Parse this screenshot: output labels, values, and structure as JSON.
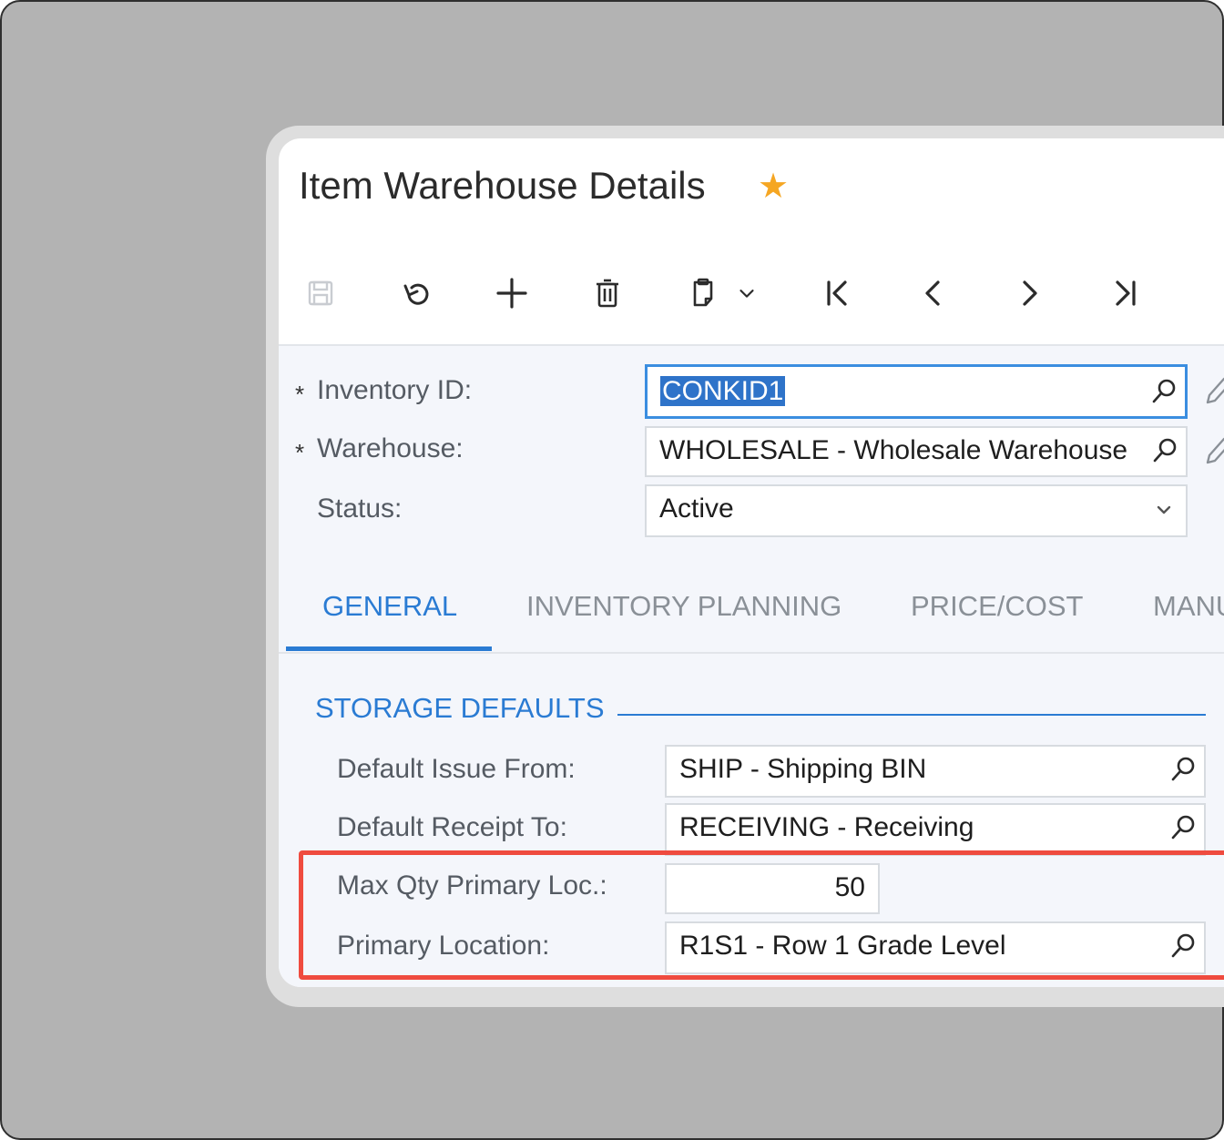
{
  "window": {
    "title": "Item Warehouse Details",
    "favorite_icon": "star-icon",
    "favorite_color": "#f5a623"
  },
  "toolbar": {
    "buttons": [
      {
        "name": "save",
        "icon": "save-icon"
      },
      {
        "name": "undo",
        "icon": "undo-icon"
      },
      {
        "name": "add",
        "icon": "plus-icon"
      },
      {
        "name": "delete",
        "icon": "trash-icon"
      },
      {
        "name": "copy-paste",
        "icon": "clipboard-icon"
      },
      {
        "name": "copy-paste-menu",
        "icon": "chevron-down-icon"
      },
      {
        "name": "first",
        "icon": "first-record-icon"
      },
      {
        "name": "previous",
        "icon": "previous-icon"
      },
      {
        "name": "next",
        "icon": "next-icon"
      },
      {
        "name": "last",
        "icon": "last-record-icon"
      }
    ]
  },
  "header": {
    "required_marker": "*",
    "inventory_id": {
      "label": "Inventory ID:",
      "value": "CONKID1"
    },
    "warehouse": {
      "label": "Warehouse:",
      "value": "WHOLESALE - Wholesale Warehouse"
    },
    "status": {
      "label": "Status:",
      "value": "Active"
    }
  },
  "tabs": [
    {
      "label": "GENERAL",
      "active": true
    },
    {
      "label": "INVENTORY PLANNING",
      "active": false
    },
    {
      "label": "PRICE/COST",
      "active": false
    },
    {
      "label": "MANU",
      "active": false
    }
  ],
  "storage_defaults": {
    "title": "STORAGE DEFAULTS",
    "default_issue_from": {
      "label": "Default Issue From:",
      "value": "SHIP - Shipping BIN"
    },
    "default_receipt_to": {
      "label": "Default Receipt To:",
      "value": "RECEIVING - Receiving"
    },
    "max_qty_primary_loc": {
      "label": "Max Qty Primary Loc.:",
      "value": "50"
    },
    "primary_location": {
      "label": "Primary Location:",
      "value": "R1S1 - Row 1 Grade Level"
    }
  },
  "colors": {
    "accent": "#2a7bd3",
    "highlight": "#ef4b3f",
    "selection": "#2e73c9"
  }
}
